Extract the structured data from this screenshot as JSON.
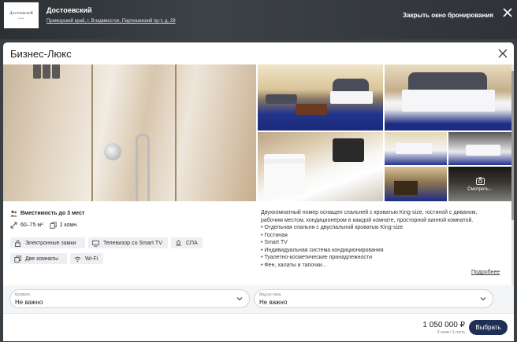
{
  "hotel": {
    "logo_text": "Достоевский",
    "logo_subtext": "отель",
    "name": "Достоевский",
    "address": "Приморский край, г. Владивосток, Партизанский пр-т, д. 29",
    "close_booking_label": "Закрыть окно бронирования"
  },
  "room": {
    "title": "Бизнес-Люкс",
    "capacity": "Вместимость до 3 мест",
    "area": "60–75 м²",
    "rooms": "2 комн.",
    "gallery_more_label": "Смотреть...",
    "amenities": [
      {
        "label": "Электронные замки",
        "icon": "lock-icon"
      },
      {
        "label": "Телевизор со Smart TV",
        "icon": "tv-icon"
      },
      {
        "label": "СПА",
        "icon": "spa-icon"
      },
      {
        "label": "Две комнаты",
        "icon": "rooms-icon"
      },
      {
        "label": "Wi-Fi",
        "icon": "wifi-icon"
      }
    ],
    "description_lines": [
      "Двухкомнатный номер оснащен спальней с кроватью King-size, гостиной с диваном,",
      "рабочим местом, кондиционером в каждой комнате, просторной ванной комнатой.",
      "• Отдельная спальня с двуспальной кроватью King-size",
      "• Гостиная",
      "• Smart TV",
      "• Индивидуальная система кондиционирования",
      "• Туалетно-косметические принадлежности",
      "• Фен, халаты и тапочки..."
    ],
    "more_link": "Подробнее"
  },
  "filters": {
    "beds": {
      "label": "Кровати",
      "value": "Не важно"
    },
    "view": {
      "label": "Вид из окна",
      "value": "Не важно"
    }
  },
  "footer": {
    "price": "1 050 000 ₽",
    "price_note": "3 ночи / 1 гость",
    "choose_label": "Выбрать"
  },
  "colors": {
    "primary_button": "#1f2f55",
    "topbar": "#2f3337"
  }
}
